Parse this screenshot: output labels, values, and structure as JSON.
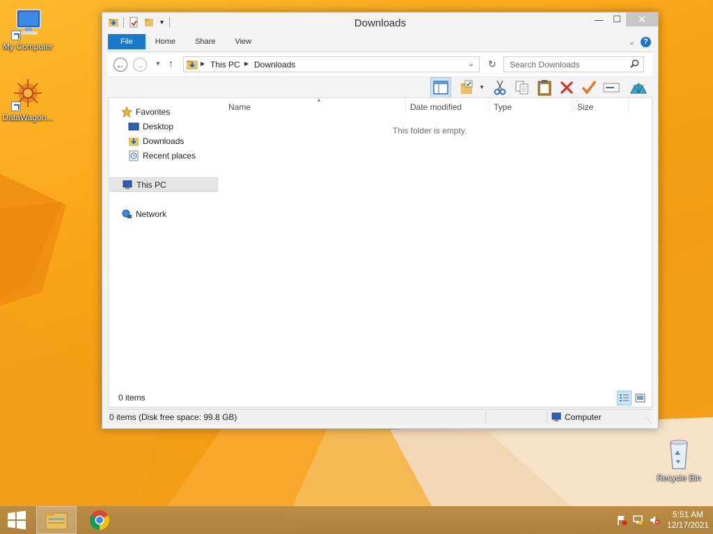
{
  "desktop": {
    "icons": [
      {
        "label": "My Computer",
        "icon": "computer-icon"
      },
      {
        "label": "DataWagon...",
        "icon": "datawagon-icon"
      },
      {
        "label": "Recycle Bin",
        "icon": "recycle-bin-icon"
      }
    ]
  },
  "window": {
    "title": "Downloads",
    "controls": {
      "minimize": "—",
      "maximize": "☐",
      "close": "✕"
    },
    "ribbon_tabs": [
      "File",
      "Home",
      "Share",
      "View"
    ],
    "address": {
      "crumbs": [
        "This PC",
        "Downloads"
      ]
    },
    "search": {
      "placeholder": "Search Downloads"
    },
    "nav_pane": {
      "favorites": "Favorites",
      "favorite_items": [
        "Desktop",
        "Downloads",
        "Recent places"
      ],
      "this_pc": "This PC",
      "network": "Network"
    },
    "columns": [
      "Name",
      "Date modified",
      "Type",
      "Size"
    ],
    "empty_message": "This folder is empty.",
    "items_count": "0 items",
    "status": {
      "left": "0 items (Disk free space: 99.8 GB)",
      "right": "Computer"
    }
  },
  "taskbar": {
    "clock_time": "5:51 AM",
    "clock_date": "12/17/2021"
  },
  "colors": {
    "accent": "#1979ca",
    "wallpaper": "#f6a11a"
  }
}
